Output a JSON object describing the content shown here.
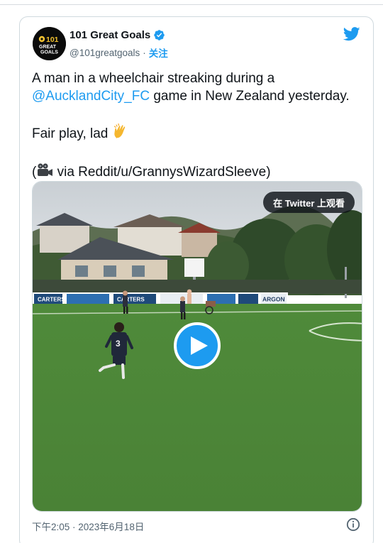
{
  "tweet": {
    "display_name": "101 Great Goals",
    "handle": "@101greatgoals",
    "separator": "·",
    "follow_label": "关注",
    "avatar_text": {
      "line1": "101",
      "line2": "GREAT",
      "line3": "GOALS"
    },
    "text": {
      "line1": "A man in a wheelchair streaking during a",
      "mention": "@AucklandCity_FC",
      "line2_rest": " game in New Zealand yesterday.",
      "line3": "Fair play, lad ",
      "line4_open": "(",
      "line4_rest": " via Reddit/u/GrannysWizardSleeve)"
    },
    "media": {
      "watch_label": "在 Twitter 上观看",
      "pitch_signs": [
        "CARTERS",
        "CARTERS",
        "ARGON"
      ],
      "player_number": "3"
    },
    "timestamp": "下午2:05 · 2023年6月18日"
  },
  "colors": {
    "accent": "#1d9bf0",
    "text": "#0f1419",
    "muted": "#536471",
    "border": "#cfd9de"
  },
  "icons": {
    "verified": "verified-badge-icon",
    "brand": "twitter-bird-icon",
    "clap": "clapping-hands-emoji",
    "camera": "movie-camera-emoji",
    "play": "play-icon",
    "info": "info-icon"
  }
}
